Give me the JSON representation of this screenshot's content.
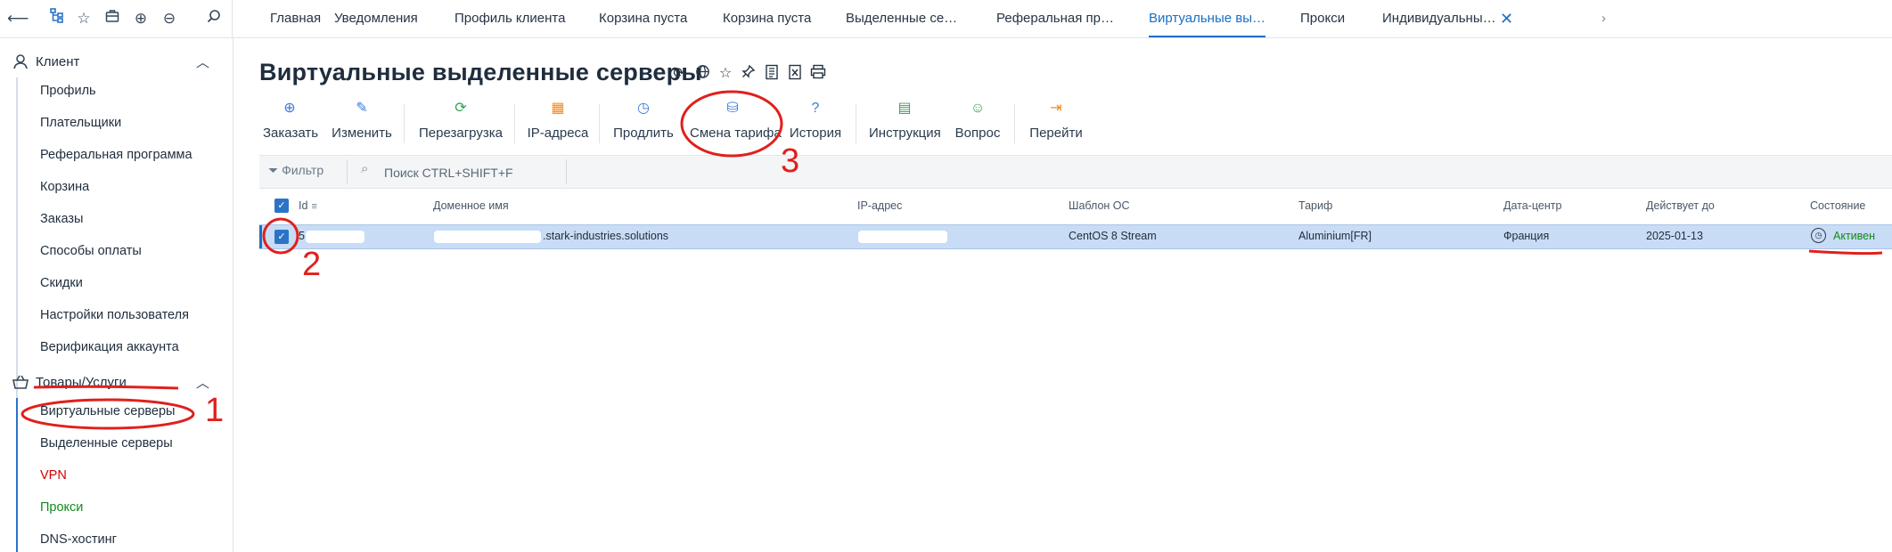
{
  "topbar": {
    "icons": [
      "back-arrow-icon",
      "tree-icon",
      "star-icon",
      "briefcase-icon",
      "plus-circle-icon",
      "minus-circle-icon",
      "search-icon"
    ],
    "tabs": [
      {
        "label": "Главная"
      },
      {
        "label": "Уведомления"
      },
      {
        "label": "Профиль клиента"
      },
      {
        "label": "Корзина пуста"
      },
      {
        "label": "Корзина пуста"
      },
      {
        "label": "Выделенные се…"
      },
      {
        "label": "Реферальная пр…"
      },
      {
        "label": "Виртуальные вы…",
        "active": true
      },
      {
        "label": "Прокси"
      },
      {
        "label": "Индивидуальны…"
      }
    ],
    "close_glyph": "✕",
    "chevron_glyph": "›"
  },
  "sidebar": {
    "client": {
      "label": "Клиент",
      "items": [
        "Профиль",
        "Плательщики",
        "Реферальная программа",
        "Корзина",
        "Заказы",
        "Способы оплаты",
        "Скидки",
        "Настройки пользователя",
        "Верификация аккаунта"
      ]
    },
    "goods": {
      "label": "Товары/Услуги",
      "items": [
        {
          "label": "Виртуальные серверы",
          "style": "normal"
        },
        {
          "label": "Выделенные серверы",
          "style": "normal"
        },
        {
          "label": "VPN",
          "style": "red"
        },
        {
          "label": "Прокси",
          "style": "green"
        },
        {
          "label": "DNS-хостинг",
          "style": "normal"
        }
      ]
    }
  },
  "main": {
    "title": "Виртуальные выделенные серверы",
    "title_icons": [
      "refresh-icon",
      "globe-icon",
      "star-icon",
      "pin-icon",
      "document-icon",
      "excel-icon",
      "print-icon"
    ],
    "toolbar": [
      {
        "label": "Заказать",
        "icon": "⊕",
        "color": "#3a7bd5"
      },
      {
        "label": "Изменить",
        "icon": "✎",
        "color": "#3a7bd5"
      },
      {
        "label": "Перезагрузка",
        "icon": "⟳",
        "color": "#2da44e"
      },
      {
        "label": "IP-адреса",
        "icon": "▦",
        "color": "#f08a24"
      },
      {
        "label": "Продлить",
        "icon": "◷",
        "color": "#3a7bd5"
      },
      {
        "label": "Смена тарифа",
        "icon": "⛁",
        "color": "#3a7bd5"
      },
      {
        "label": "История",
        "icon": "?",
        "color": "#3a7bd5"
      },
      {
        "label": "Инструкция",
        "icon": "▤",
        "color": "#2da44e"
      },
      {
        "label": "Вопрос",
        "icon": "☺",
        "color": "#2da44e"
      },
      {
        "label": "Перейти",
        "icon": "⇥",
        "color": "#f08a24"
      }
    ],
    "filter": {
      "label": "Фильтр",
      "search_placeholder": "Поиск CTRL+SHIFT+F"
    },
    "table": {
      "columns": [
        "Id",
        "Доменное имя",
        "IP-адрес",
        "Шаблон ОС",
        "Тариф",
        "Дата-центр",
        "Действует до",
        "Состояние"
      ],
      "rows": [
        {
          "id": "5",
          "domain": ".stark-industries.solutions",
          "ip": "",
          "os": "CentOS 8 Stream",
          "tariff": "Aluminium[FR]",
          "dc": "Франция",
          "until": "2025-01-13",
          "status": "Активен"
        }
      ]
    }
  },
  "annotations": {
    "labels": [
      "1",
      "2",
      "3"
    ],
    "color": "#e0201c"
  }
}
